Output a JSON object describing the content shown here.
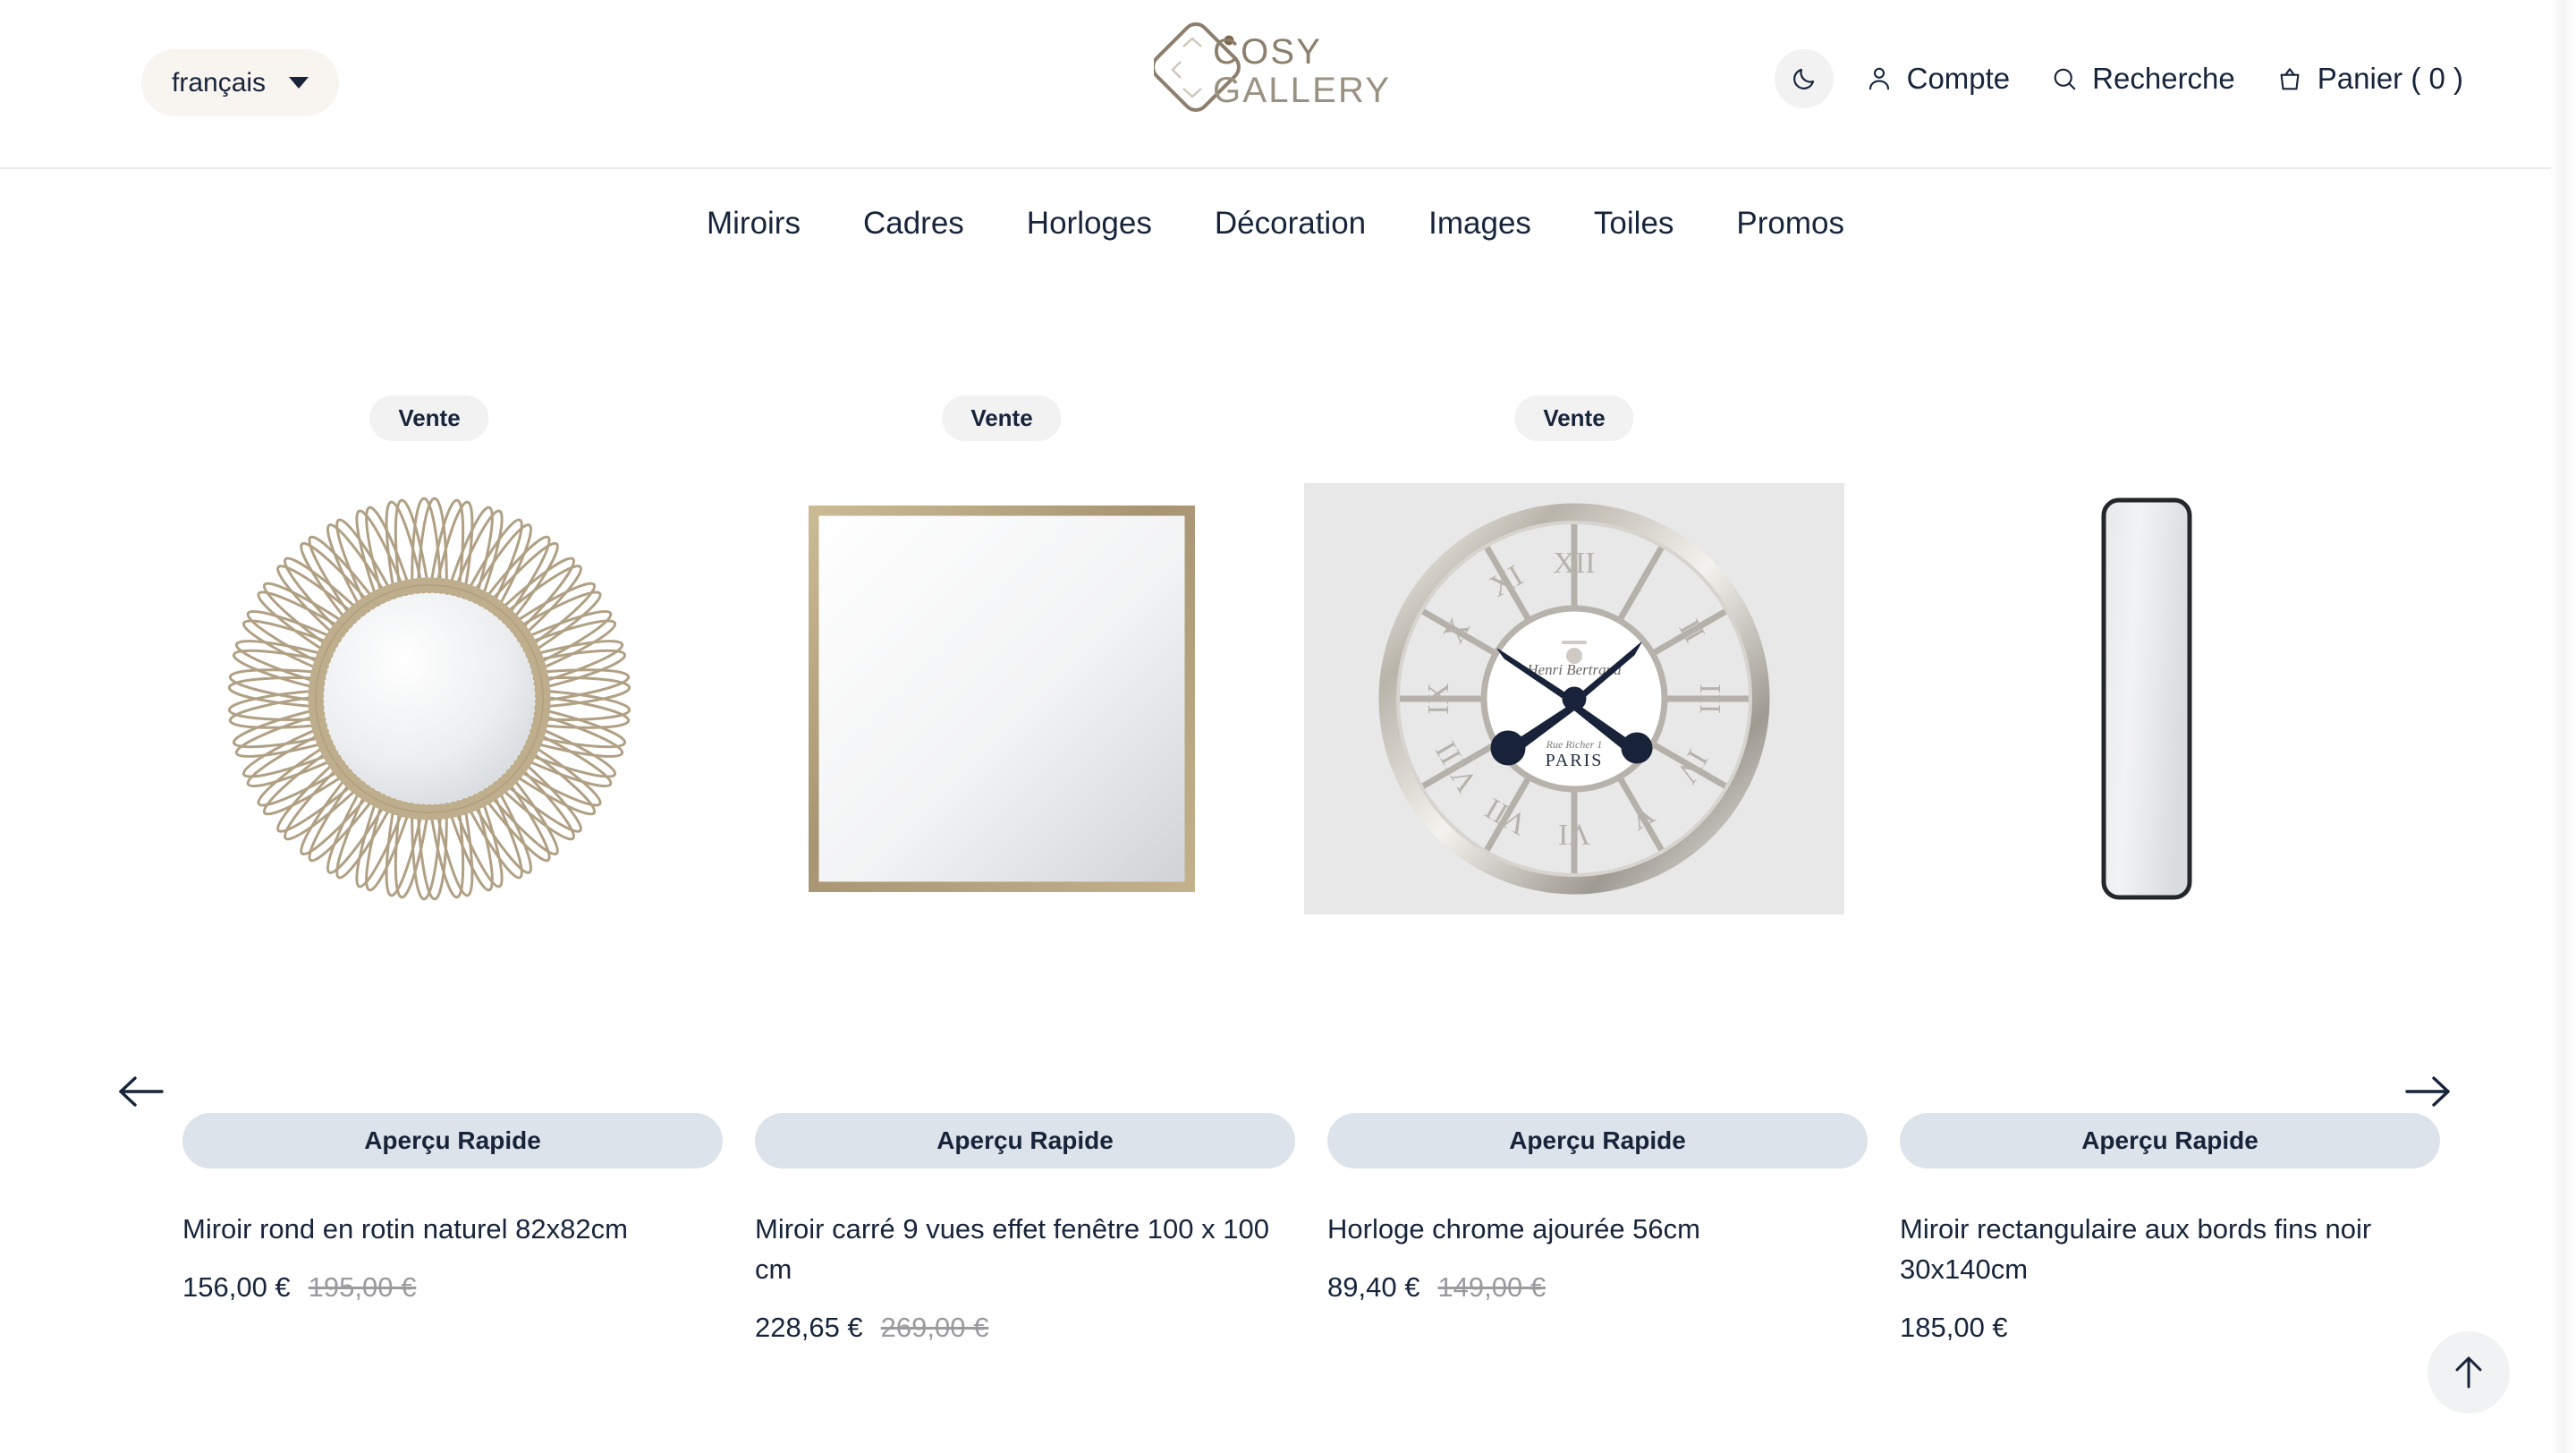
{
  "header": {
    "language": {
      "label": "français",
      "icon": "chevron-down-icon"
    },
    "logo": {
      "line1": "COSY",
      "line2": "GALLERY"
    },
    "dark_mode_icon": "moon-icon",
    "account": {
      "label": "Compte",
      "icon": "user-icon"
    },
    "search": {
      "label": "Recherche",
      "icon": "search-icon"
    },
    "cart": {
      "label": "Panier ( 0 )",
      "icon": "shopping-bag-icon",
      "count": 0
    }
  },
  "nav": {
    "items": [
      {
        "label": "Miroirs"
      },
      {
        "label": "Cadres"
      },
      {
        "label": "Horloges"
      },
      {
        "label": "Décoration"
      },
      {
        "label": "Images"
      },
      {
        "label": "Toiles"
      },
      {
        "label": "Promos"
      }
    ]
  },
  "carousel": {
    "prev_label": "←",
    "next_label": "→",
    "quick_view_label": "Aperçu Rapide",
    "sale_badge_label": "Vente",
    "products": [
      {
        "badge": "Vente",
        "title": "Miroir rond en rotin naturel 82x82cm",
        "price": "156,00 €",
        "compare_at_price": "195,00 €",
        "image": "round-rattan-mirror"
      },
      {
        "badge": "Vente",
        "title": "Miroir carré 9 vues effet fenêtre 100 x 100 cm",
        "price": "228,65 €",
        "compare_at_price": "269,00 €",
        "image": "square-window-mirror"
      },
      {
        "badge": "Vente",
        "title": "Horloge chrome ajourée 56cm",
        "price": "89,40 €",
        "compare_at_price": "149,00 €",
        "image": "chrome-skeleton-clock",
        "clock_dial_text": "PARIS"
      },
      {
        "badge": "",
        "title": "Miroir rectangulaire aux bords fins noir 30x140cm",
        "price": "185,00 €",
        "compare_at_price": "",
        "image": "tall-black-rectangular-mirror"
      }
    ]
  },
  "scroll_top": {
    "icon": "arrow-up-icon"
  },
  "colors": {
    "text": "#17243a",
    "logo": "#8d7f6d",
    "lang_pill_bg": "#f8f4f0",
    "badge_bg": "#f2f2f3",
    "quick_view_bg": "#dde3ea",
    "old_price": "#9a9a9f",
    "rattan": "#b3a283",
    "frame_gold": "#b9a87f",
    "clock_bg": "#e8e8e8"
  }
}
